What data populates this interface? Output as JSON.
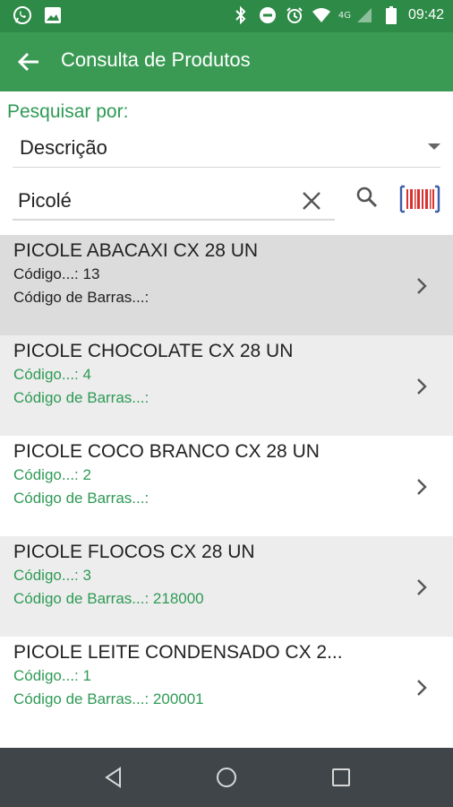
{
  "status_bar": {
    "time": "09:42",
    "network": "4G",
    "icons": [
      "whatsapp-icon",
      "image-icon",
      "bluetooth-icon",
      "dnd-icon",
      "alarm-icon",
      "wifi-icon",
      "signal-icon",
      "battery-icon"
    ]
  },
  "app_bar": {
    "title": "Consulta de Produtos",
    "back_icon": "arrow-back-icon",
    "color": "#3a9a54"
  },
  "search": {
    "label": "Pesquisar por:",
    "criteria_selected": "Descrição",
    "query": "Picolé",
    "accent_color": "#2e9a55"
  },
  "products": [
    {
      "name": "PICOLE ABACAXI CX 28 UN",
      "code": "Código...: 13",
      "barcode": "Código de Barras...:",
      "style": "selected"
    },
    {
      "name": "PICOLE CHOCOLATE CX 28 UN",
      "code": "Código...: 4",
      "barcode": "Código de Barras...:",
      "style": "alt"
    },
    {
      "name": "PICOLE COCO BRANCO CX 28 UN",
      "code": "Código...: 2",
      "barcode": "Código de Barras...:",
      "style": "plain"
    },
    {
      "name": "PICOLE FLOCOS CX 28 UN",
      "code": "Código...: 3",
      "barcode": "Código de Barras...: 218000",
      "style": "alt"
    },
    {
      "name": "PICOLE LEITE CONDENSADO CX 2...",
      "code": "Código...: 1",
      "barcode": "Código de Barras...: 200001",
      "style": "plain"
    }
  ],
  "nav_bar": {
    "buttons": [
      "back-nav-icon",
      "home-nav-icon",
      "recents-nav-icon"
    ]
  }
}
